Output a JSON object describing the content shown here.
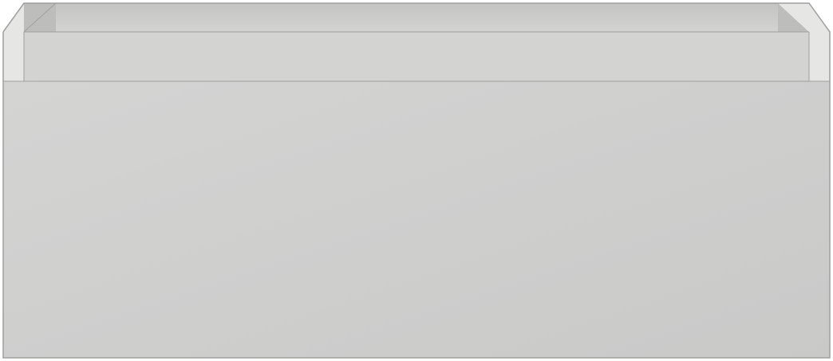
{
  "product": {
    "name": "",
    "colors": {
      "background": "#ffffff",
      "front_panel_light": "#d4d4d3",
      "front_panel_dark": "#c9c9c8",
      "top_rim": "#d3d3d2",
      "inner_back_wall": "#c4c4c3",
      "inner_side_wall": "#bdbdbc",
      "outline": "#9f9f9e",
      "edge_highlight": "#e6e6e5"
    }
  }
}
